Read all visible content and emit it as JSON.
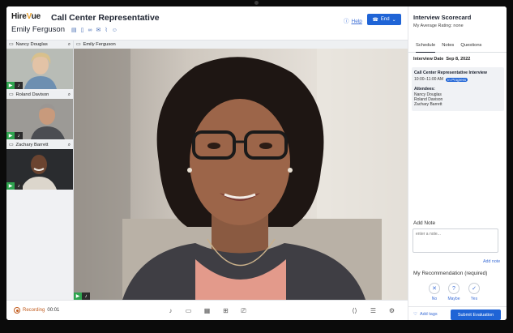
{
  "brand": {
    "name_prefix": "Hire",
    "name_accent": "V",
    "name_suffix": "ue"
  },
  "header": {
    "job_title": "Call Center Representative",
    "candidate_name": "Emily Ferguson",
    "help_label": "Help",
    "end_label": "End",
    "icons": [
      "document-icon",
      "file-icon",
      "link-icon",
      "email-icon",
      "attachment-icon",
      "person-icon"
    ]
  },
  "thumbnails": [
    {
      "name": "Nancy Douglas"
    },
    {
      "name": "Roland Davison"
    },
    {
      "name": "Zachary Barrett"
    }
  ],
  "main_video": {
    "name": "Emily Ferguson"
  },
  "bottom_bar": {
    "recording_label": "Recording",
    "recording_time": "00:01"
  },
  "scorecard": {
    "title": "Interview Scorecard",
    "subtitle": "My Average Rating: none",
    "tabs": [
      "Schedule",
      "Notes",
      "Questions"
    ],
    "active_tab": "Schedule",
    "interview_date_label": "Interview Date",
    "interview_date": "Sep 8, 2022",
    "card": {
      "title": "Call Center Representative Interview",
      "time": "10:00–11:00 AM",
      "status": "In Progress",
      "attendees_label": "Attendees:",
      "attendees": [
        "Nancy Douglas",
        "Roland Davison",
        "Zachary Barrett"
      ]
    },
    "add_note_label": "Add Note",
    "note_placeholder": "enter a note...",
    "add_note_link": "Add note",
    "recommendation_label": "My Recommendation (required)",
    "choices": [
      {
        "label": "No",
        "icon": "x-icon"
      },
      {
        "label": "Maybe",
        "icon": "question-icon"
      },
      {
        "label": "Yes",
        "icon": "check-icon"
      }
    ],
    "add_tags_label": "Add tags",
    "submit_label": "Submit Evaluation"
  },
  "colors": {
    "accent": "#1f64d6",
    "badge_green": "#2fa44f",
    "recording": "#c15b1c"
  }
}
